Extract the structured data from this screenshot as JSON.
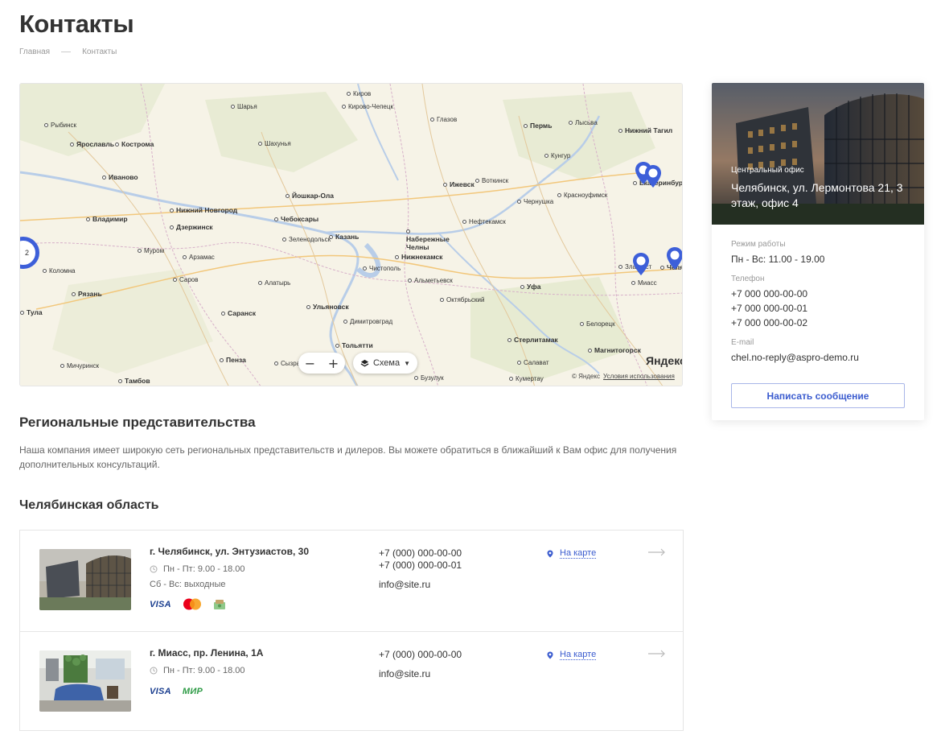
{
  "page": {
    "title": "Контакты",
    "breadcrumb": [
      "Главная",
      "Контакты"
    ]
  },
  "map": {
    "cities": [
      {
        "name": "Киров",
        "big": false
      },
      {
        "name": "Кирово-Чепецк",
        "big": false
      },
      {
        "name": "Шарья",
        "big": false
      },
      {
        "name": "Рыбинск",
        "big": false
      },
      {
        "name": "Ярославль",
        "big": true
      },
      {
        "name": "Кострома",
        "big": true
      },
      {
        "name": "Иваново",
        "big": true
      },
      {
        "name": "Владимир",
        "big": true
      },
      {
        "name": "Нижний Новгород",
        "big": true
      },
      {
        "name": "Дзержинск",
        "big": true
      },
      {
        "name": "Шахунья",
        "big": false
      },
      {
        "name": "Йошкар-Ола",
        "big": true
      },
      {
        "name": "Чебоксары",
        "big": true
      },
      {
        "name": "Казань",
        "big": true
      },
      {
        "name": "Зеленодольск",
        "big": false
      },
      {
        "name": "Глазов",
        "big": false
      },
      {
        "name": "Пермь",
        "big": true
      },
      {
        "name": "Лысьва",
        "big": false
      },
      {
        "name": "Нижний Тагил",
        "big": true
      },
      {
        "name": "Кунгур",
        "big": false
      },
      {
        "name": "Ижевск",
        "big": true
      },
      {
        "name": "Воткинск",
        "big": false
      },
      {
        "name": "Чернушка",
        "big": false
      },
      {
        "name": "Красноуфимск",
        "big": false
      },
      {
        "name": "Екатеринбург",
        "big": true
      },
      {
        "name": "Нефтекамск",
        "big": false
      },
      {
        "name": "Набережные Челны",
        "big": true
      },
      {
        "name": "Нижнекамск",
        "big": true
      },
      {
        "name": "Чистополь",
        "big": false
      },
      {
        "name": "Альметьевск",
        "big": false
      },
      {
        "name": "Октябрьский",
        "big": false
      },
      {
        "name": "Уфа",
        "big": true
      },
      {
        "name": "Златоуст",
        "big": false
      },
      {
        "name": "Миасс",
        "big": false
      },
      {
        "name": "Челябинск",
        "big": true
      },
      {
        "name": "Белорецк",
        "big": false
      },
      {
        "name": "Стерлитамак",
        "big": true
      },
      {
        "name": "Салават",
        "big": false
      },
      {
        "name": "Магнитогорск",
        "big": true
      },
      {
        "name": "Кумертау",
        "big": false
      },
      {
        "name": "Бузулук",
        "big": false
      },
      {
        "name": "Тольятти",
        "big": true
      },
      {
        "name": "Димитровград",
        "big": false
      },
      {
        "name": "Ульяновск",
        "big": true
      },
      {
        "name": "Сызрань",
        "big": false
      },
      {
        "name": "Саранск",
        "big": true
      },
      {
        "name": "Пенза",
        "big": true
      },
      {
        "name": "Алатырь",
        "big": false
      },
      {
        "name": "Арзамас",
        "big": false
      },
      {
        "name": "Саров",
        "big": false
      },
      {
        "name": "Муром",
        "big": false
      },
      {
        "name": "Коломна",
        "big": false
      },
      {
        "name": "Рязань",
        "big": true
      },
      {
        "name": "Тула",
        "big": true
      },
      {
        "name": "Тамбов",
        "big": true
      },
      {
        "name": "Мичуринск",
        "big": false
      }
    ],
    "cluster_count": "2",
    "zoom_out": "−",
    "zoom_in": "+",
    "scheme_label": "Схема",
    "logo": "Яндекс",
    "copyright": "© Яндекс",
    "terms": "Условия использования"
  },
  "card": {
    "office_label": "Центральный офис",
    "office_address": "Челябинск, ул. Лермонтова 21, 3 этаж, офис 4",
    "hours_label": "Режим работы",
    "hours_value": "Пн - Вс: 11.00 - 19.00",
    "phone_label": "Телефон",
    "phones": [
      "+7 000 000-00-00",
      "+7 000 000-00-01",
      "+7 000 000-00-02"
    ],
    "email_label": "E-mail",
    "email": "chel.no-reply@aspro-demo.ru",
    "button": "Написать сообщение"
  },
  "regional": {
    "title": "Региональные представительства",
    "description": "Наша компания имеет широкую сеть региональных представительств и дилеров. Вы можете обратиться в ближайший к Вам офис для получения дополнительных консультаций.",
    "region_title": "Челябинская область"
  },
  "offices": [
    {
      "address": "г. Челябинск, ул. Энтузиастов, 30",
      "hours": "Пн - Пт: 9.00 - 18.00",
      "hours_extra": "Сб - Вс: выходные",
      "payments": [
        "VISA",
        "mastercard",
        "cash"
      ],
      "phones": [
        "+7 (000) 000-00-00",
        "+7 (000) 000-00-01"
      ],
      "email": "info@site.ru",
      "map_link": "На карте"
    },
    {
      "address": "г. Миасс, пр. Ленина, 1А",
      "hours": "Пн - Пт: 9.00 - 18.00",
      "payments": [
        "VISA",
        "МИР"
      ],
      "phones": [
        "+7 (000) 000-00-00"
      ],
      "email": "info@site.ru",
      "map_link": "На карте"
    }
  ],
  "colors": {
    "accent": "#3b5ccf",
    "pin": "#3d5fd9",
    "map_land": "#f6f3e7",
    "map_water": "#b8cde8"
  }
}
